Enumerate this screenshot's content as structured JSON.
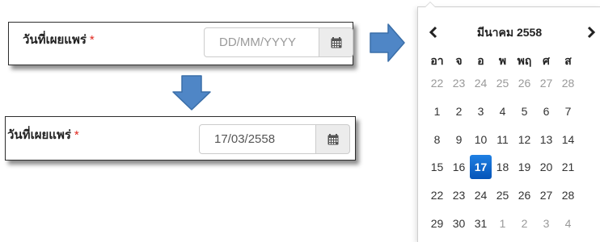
{
  "field": {
    "label": "วันที่เผยแพร่",
    "required_mark": "*",
    "placeholder": "DD/MM/YYYY",
    "value": "17/03/2558"
  },
  "icons": {
    "calendar": "calendar-icon",
    "arrow_right": "arrow-right-icon",
    "arrow_down": "arrow-down-icon",
    "prev": "chevron-left-icon",
    "next": "chevron-right-icon"
  },
  "colors": {
    "arrow": "#4a7fc1",
    "selected_day": "#0b6ad0",
    "required": "#e0281f"
  },
  "datepicker": {
    "prev_label": "‹",
    "next_label": "›",
    "title": "มีนาคม 2558",
    "weekdays": [
      "อา",
      "จ",
      "อ",
      "พ",
      "พฤ",
      "ศ",
      "ส"
    ],
    "weeks": [
      [
        {
          "d": "22",
          "m": true
        },
        {
          "d": "23",
          "m": true
        },
        {
          "d": "24",
          "m": true
        },
        {
          "d": "25",
          "m": true
        },
        {
          "d": "26",
          "m": true
        },
        {
          "d": "27",
          "m": true
        },
        {
          "d": "28",
          "m": true
        }
      ],
      [
        {
          "d": "1"
        },
        {
          "d": "2"
        },
        {
          "d": "3"
        },
        {
          "d": "4"
        },
        {
          "d": "5"
        },
        {
          "d": "6"
        },
        {
          "d": "7"
        }
      ],
      [
        {
          "d": "8"
        },
        {
          "d": "9"
        },
        {
          "d": "10"
        },
        {
          "d": "11"
        },
        {
          "d": "12"
        },
        {
          "d": "13"
        },
        {
          "d": "14"
        }
      ],
      [
        {
          "d": "15"
        },
        {
          "d": "16"
        },
        {
          "d": "17",
          "s": true
        },
        {
          "d": "18"
        },
        {
          "d": "19"
        },
        {
          "d": "20"
        },
        {
          "d": "21"
        }
      ],
      [
        {
          "d": "22"
        },
        {
          "d": "23"
        },
        {
          "d": "24"
        },
        {
          "d": "25"
        },
        {
          "d": "26"
        },
        {
          "d": "27"
        },
        {
          "d": "28"
        }
      ],
      [
        {
          "d": "29"
        },
        {
          "d": "30"
        },
        {
          "d": "31"
        },
        {
          "d": "1",
          "m": true
        },
        {
          "d": "2",
          "m": true
        },
        {
          "d": "3",
          "m": true
        },
        {
          "d": "4",
          "m": true
        }
      ]
    ]
  }
}
